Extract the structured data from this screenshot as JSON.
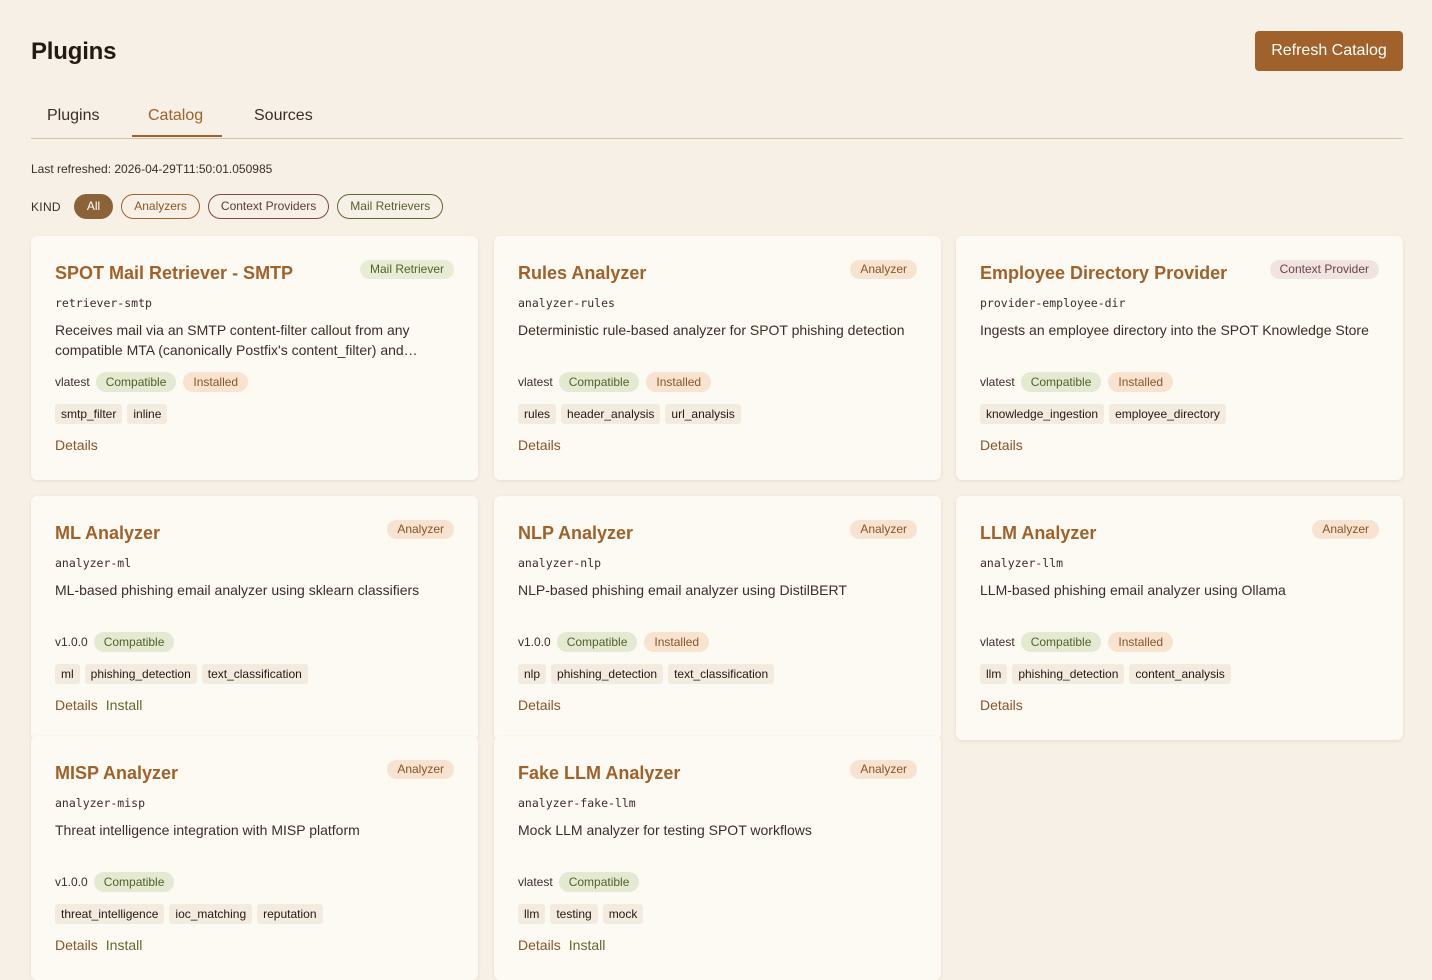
{
  "header": {
    "title": "Plugins",
    "refresh_label": "Refresh Catalog"
  },
  "tabs": [
    {
      "label": "Plugins",
      "active": false
    },
    {
      "label": "Catalog",
      "active": true
    },
    {
      "label": "Sources",
      "active": false
    }
  ],
  "catalog": {
    "last_refreshed": "Last refreshed: 2026-04-29T11:50:01.050985",
    "kind_label": "KIND",
    "filters": [
      "All",
      "Analyzers",
      "Context Providers",
      "Mail Retrievers"
    ],
    "selected_filter": "All"
  },
  "labels": {
    "details": "Details",
    "install": "Install",
    "compatible": "Compatible",
    "installed": "Installed"
  },
  "colors": {
    "accent": "#a0622a",
    "background": "#f7f0e6",
    "card": "#fdf9f3",
    "compatible": "#52602a"
  },
  "plugins": [
    {
      "title": "SPOT Mail Retriever - SMTP",
      "kind": "Mail Retriever",
      "id": "retriever-smtp",
      "description": "Receives mail via an SMTP content-filter callout from any compatible MTA (canonically Postfix's content_filter) and…",
      "version": "vlatest",
      "compatible": true,
      "installed": true,
      "tags": [
        "smtp_filter",
        "inline"
      ],
      "installable": false
    },
    {
      "title": "Rules Analyzer",
      "kind": "Analyzer",
      "id": "analyzer-rules",
      "description": "Deterministic rule-based analyzer for SPOT phishing detection",
      "version": "vlatest",
      "compatible": true,
      "installed": true,
      "tags": [
        "rules",
        "header_analysis",
        "url_analysis"
      ],
      "installable": false
    },
    {
      "title": "Employee Directory Provider",
      "kind": "Context Provider",
      "id": "provider-employee-dir",
      "description": "Ingests an employee directory into the SPOT Knowledge Store",
      "version": "vlatest",
      "compatible": true,
      "installed": true,
      "tags": [
        "knowledge_ingestion",
        "employee_directory"
      ],
      "installable": false
    },
    {
      "title": "ML Analyzer",
      "kind": "Analyzer",
      "id": "analyzer-ml",
      "description": "ML-based phishing email analyzer using sklearn classifiers",
      "version": "v1.0.0",
      "compatible": true,
      "installed": false,
      "tags": [
        "ml",
        "phishing_detection",
        "text_classification"
      ],
      "installable": true
    },
    {
      "title": "NLP Analyzer",
      "kind": "Analyzer",
      "id": "analyzer-nlp",
      "description": "NLP-based phishing email analyzer using DistilBERT",
      "version": "v1.0.0",
      "compatible": true,
      "installed": true,
      "tags": [
        "nlp",
        "phishing_detection",
        "text_classification"
      ],
      "installable": false
    },
    {
      "title": "LLM Analyzer",
      "kind": "Analyzer",
      "id": "analyzer-llm",
      "description": "LLM-based phishing email analyzer using Ollama",
      "version": "vlatest",
      "compatible": true,
      "installed": true,
      "tags": [
        "llm",
        "phishing_detection",
        "content_analysis"
      ],
      "installable": false
    },
    {
      "title": "MISP Analyzer",
      "kind": "Analyzer",
      "id": "analyzer-misp",
      "description": "Threat intelligence integration with MISP platform",
      "version": "v1.0.0",
      "compatible": true,
      "installed": false,
      "tags": [
        "threat_intelligence",
        "ioc_matching",
        "reputation"
      ],
      "installable": true
    },
    {
      "title": "Fake LLM Analyzer",
      "kind": "Analyzer",
      "id": "analyzer-fake-llm",
      "description": "Mock LLM analyzer for testing SPOT workflows",
      "version": "vlatest",
      "compatible": true,
      "installed": false,
      "tags": [
        "llm",
        "testing",
        "mock"
      ],
      "installable": true
    }
  ]
}
